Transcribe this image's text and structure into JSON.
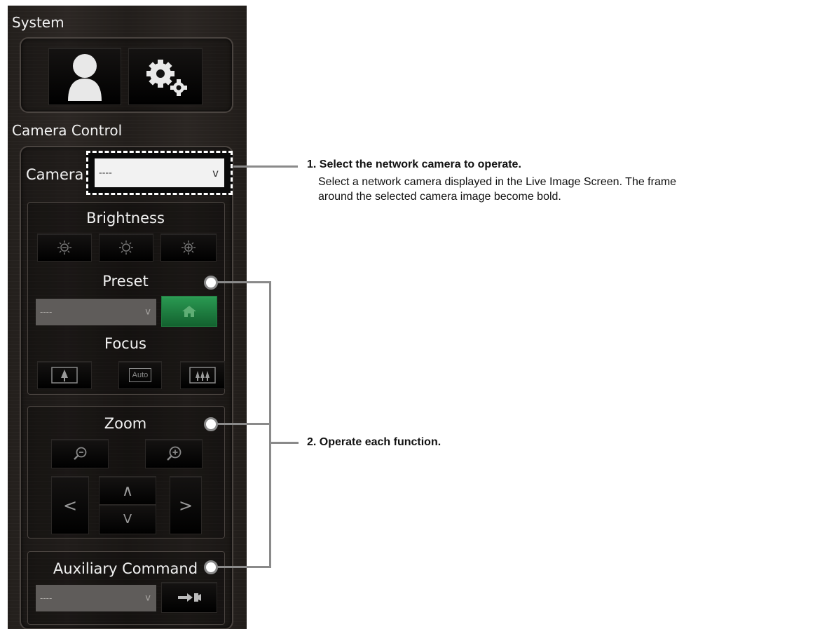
{
  "system": {
    "heading": "System",
    "buttons": [
      {
        "icon": "user-icon"
      },
      {
        "icon": "settings-gears-icon"
      }
    ]
  },
  "camera_control": {
    "heading": "Camera Control",
    "camera_label": "Camera",
    "camera_select_value": "----",
    "camera_select_chevron": "v",
    "brightness": {
      "label": "Brightness",
      "buttons": [
        "brightness-decrease-icon",
        "brightness-reset-icon",
        "brightness-increase-icon"
      ]
    },
    "preset": {
      "label": "Preset",
      "select_value": "----",
      "select_chevron": "v",
      "home_icon": "home-icon",
      "home_color": "#1e7a3e"
    },
    "focus": {
      "label": "Focus",
      "auto_label": "Auto",
      "buttons": [
        "focus-near-icon",
        "focus-auto-icon",
        "focus-far-icon"
      ]
    },
    "zoom": {
      "label": "Zoom",
      "buttons": [
        "zoom-out-icon",
        "zoom-in-icon"
      ],
      "pan_left": "<",
      "pan_right": ">",
      "tilt_up": "∧",
      "tilt_down": "V"
    },
    "auxiliary": {
      "label": "Auxiliary Command",
      "select_value": "----",
      "select_chevron": "v",
      "send_icon": "send-command-icon"
    }
  },
  "callouts": {
    "c1_title": "1. Select the network camera to operate.",
    "c1_line1": "Select a network camera displayed in the Live Image Screen. The frame",
    "c1_line2": "around the selected camera image become bold.",
    "c2_title": "2. Operate each function."
  }
}
